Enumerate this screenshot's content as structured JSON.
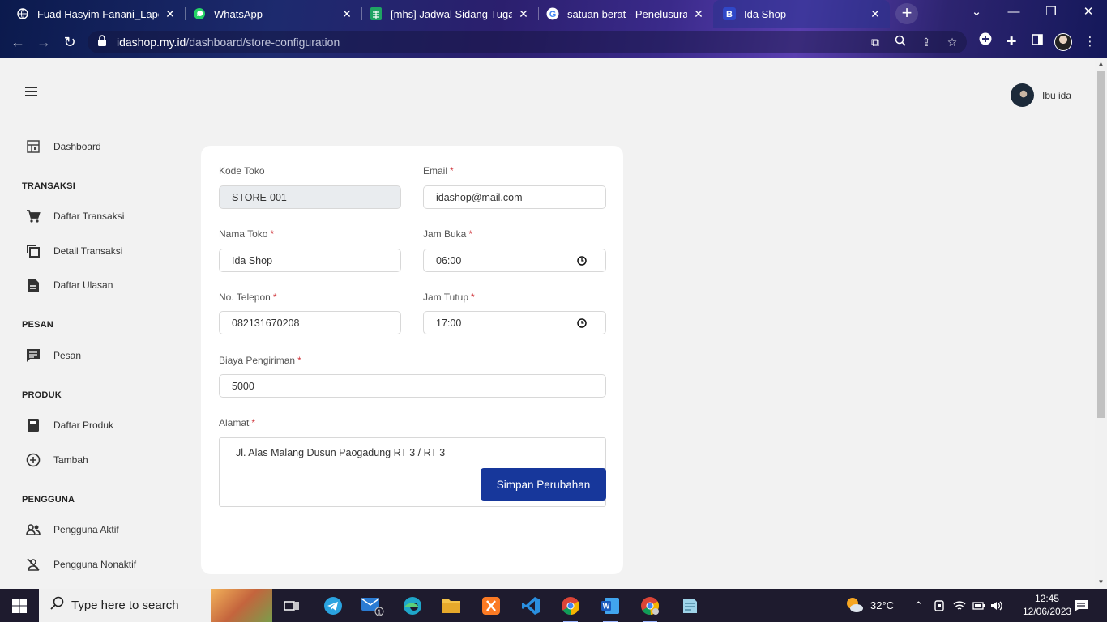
{
  "browser": {
    "tabs": [
      {
        "label": "Fuad Hasyim Fanani_Laporan",
        "icon": "globe-icon"
      },
      {
        "label": "WhatsApp",
        "icon": "whatsapp-icon"
      },
      {
        "label": "[mhs] Jadwal Sidang Tugas A",
        "icon": "sheets-icon"
      },
      {
        "label": "satuan berat - Penelusuran G",
        "icon": "google-icon"
      },
      {
        "label": "Ida Shop",
        "icon": "bootstrap-icon"
      }
    ],
    "url_host": "idashop.my.id",
    "url_path": "/dashboard/store-configuration"
  },
  "header": {
    "user_name": "Ibu ida"
  },
  "sidebar": {
    "dashboard": "Dashboard",
    "sections": [
      {
        "title": "TRANSAKSI",
        "items": [
          "Daftar Transaksi",
          "Detail Transaksi",
          "Daftar Ulasan"
        ]
      },
      {
        "title": "PESAN",
        "items": [
          "Pesan"
        ]
      },
      {
        "title": "PRODUK",
        "items": [
          "Daftar Produk",
          "Tambah"
        ]
      },
      {
        "title": "PENGGUNA",
        "items": [
          "Pengguna Aktif",
          "Pengguna Nonaktif"
        ]
      }
    ]
  },
  "form": {
    "kode_toko": {
      "label": "Kode Toko",
      "value": "STORE-001"
    },
    "email": {
      "label": "Email",
      "value": "idashop@mail.com"
    },
    "nama_toko": {
      "label": "Nama Toko",
      "value": "Ida Shop"
    },
    "jam_buka": {
      "label": "Jam Buka",
      "value": "06:00"
    },
    "telepon": {
      "label": "No. Telepon",
      "value": "082131670208"
    },
    "jam_tutup": {
      "label": "Jam Tutup",
      "value": "17:00"
    },
    "biaya": {
      "label": "Biaya Pengiriman",
      "value": "5000"
    },
    "alamat": {
      "label": "Alamat",
      "value": "Jl. Alas Malang Dusun Paogadung RT 3 / RT 3"
    },
    "required_mark": "*",
    "submit_label": "Simpan Perubahan"
  },
  "taskbar": {
    "search_placeholder": "Type here to search",
    "weather": "32°C",
    "time": "12:45",
    "date": "12/06/2023",
    "mail_badge": "1"
  },
  "colors": {
    "primary": "#17379b",
    "required": "#d0373d"
  }
}
